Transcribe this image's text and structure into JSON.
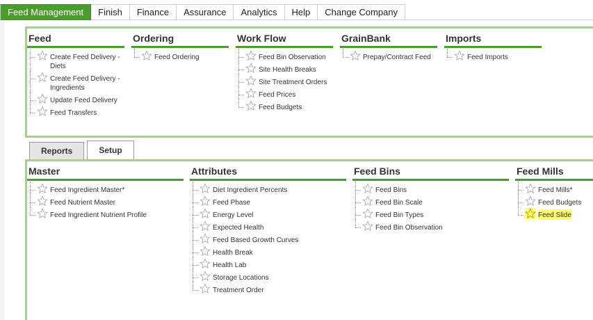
{
  "topnav": {
    "tabs": [
      {
        "label": "Feed Management",
        "active": true
      },
      {
        "label": "Finish"
      },
      {
        "label": "Finance"
      },
      {
        "label": "Assurance"
      },
      {
        "label": "Analytics"
      },
      {
        "label": "Help"
      },
      {
        "label": "Change Company"
      }
    ]
  },
  "panel1": {
    "feed": {
      "title": "Feed",
      "items": [
        "Create Feed Delivery - Diets",
        "Create Feed Delivery - Ingredients",
        "Update Feed Delivery",
        "Feed Transfers"
      ]
    },
    "ordering": {
      "title": "Ordering",
      "items": [
        "Feed Ordering"
      ]
    },
    "workflow": {
      "title": "Work Flow",
      "items": [
        "Feed Bin Observation",
        "Site Health Breaks",
        "Site Treatment Orders",
        "Feed Prices",
        "Feed Budgets"
      ]
    },
    "grainbank": {
      "title": "GrainBank",
      "items": [
        "Prepay/Contract Feed"
      ]
    },
    "imports": {
      "title": "Imports",
      "items": [
        "Feed Imports"
      ]
    }
  },
  "subtabs": [
    {
      "label": "Reports"
    },
    {
      "label": "Setup",
      "active": true
    }
  ],
  "panel2": {
    "master": {
      "title": "Master",
      "items": [
        "Feed Ingredient Master*",
        "Feed Nutrient Master",
        "Feed Ingredient Nutrient Profile"
      ]
    },
    "attributes": {
      "title": "Attributes",
      "items": [
        "Diet Ingredient Percents",
        "Feed Phase",
        "Energy Level",
        "Expected Health",
        "Feed Based Growth Curves",
        "Health Break",
        "Health Lab",
        "Storage Locations",
        "Treatment Order"
      ]
    },
    "feedbins": {
      "title": "Feed Bins",
      "items": [
        "Feed Bins",
        "Feed Bin Scale",
        "Feed Bin Types",
        "Feed Bin Observation"
      ]
    },
    "feedmills": {
      "title": "Feed Mills",
      "items": [
        "Feed Mills*",
        "Feed Budgets",
        "Feed Slide"
      ]
    }
  },
  "colors": {
    "accent": "#4a9c2d",
    "panel_border": "#a8d08d",
    "highlight": "#fbfb6b"
  },
  "icons": {
    "item_icon": "star-outline-icon"
  }
}
